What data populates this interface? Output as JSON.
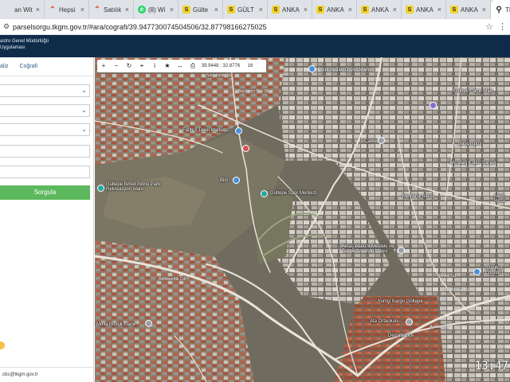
{
  "browser": {
    "tabs": [
      {
        "icon": "generic",
        "label": "an Wit"
      },
      {
        "icon": "hepsiburada",
        "label": "Hepsi"
      },
      {
        "icon": "hepsiburada",
        "label": "Satılık"
      },
      {
        "icon": "whatsapp",
        "label": "(8) Wi"
      },
      {
        "icon": "s",
        "label": "Gülte"
      },
      {
        "icon": "s",
        "label": "GÜLT"
      },
      {
        "icon": "s",
        "label": "ANKA"
      },
      {
        "icon": "s",
        "label": "ANKA"
      },
      {
        "icon": "s",
        "label": "ANKA"
      },
      {
        "icon": "s",
        "label": "ANKA"
      },
      {
        "icon": "s",
        "label": "ANKA"
      },
      {
        "icon": "location",
        "label": "TKGM",
        "active": true
      }
    ],
    "close_glyph": "×",
    "url": "parselsorgu.tkgm.gov.tr/#ara/cografi/39.947730074504506/32.87798166275025"
  },
  "site": {
    "header_line1": "astro Genel Müdürlüğü",
    "header_line2": "Uygulaması"
  },
  "sidebar": {
    "tabs": [
      {
        "label": "aliz"
      },
      {
        "label": "Coğrafi",
        "active": true
      }
    ],
    "query_button": "Sorgula",
    "email": "cbs@tkgm.gov.tr"
  },
  "map": {
    "toolbar": {
      "zoom_in": "+",
      "zoom_out": "−",
      "refresh": "↻",
      "locate": "⌖",
      "info": "i",
      "favorite": "★",
      "measure": "↔",
      "print": "⎙",
      "coords": "39.9448 ; 32.8776",
      "zoom_level": "16"
    },
    "labels": [
      "Sabahattin Sk.",
      "Yeni Sultan Gross Market",
      "Fatih 2 Tekel Market",
      "Bim",
      "Gültepe Spor Merkezi",
      "Gültepe İsmet İnönü Park Rekreasyon Alanı",
      "Aktaş Atatürk Mesleki ve Teknik Anadolu Lisesi",
      "Molla Büyük Camii",
      "Yurtiçi Kargo Gültepe",
      "Ata Ortaokulu",
      "Demirbahçe",
      "Cami",
      "Başçimpos",
      "Altındağ Kültür Sarayı",
      "Mevlana Sitesi",
      "İstanbul Endüstri",
      "Mem Resu",
      "Ulubey Camii Mad",
      "Bayramcı Pay Sk.",
      "Bendderesi Cd.",
      "Plevne Cd.",
      "Arif Yıldız Cd.",
      "Ayakan Cd."
    ],
    "clock": "13:47"
  }
}
